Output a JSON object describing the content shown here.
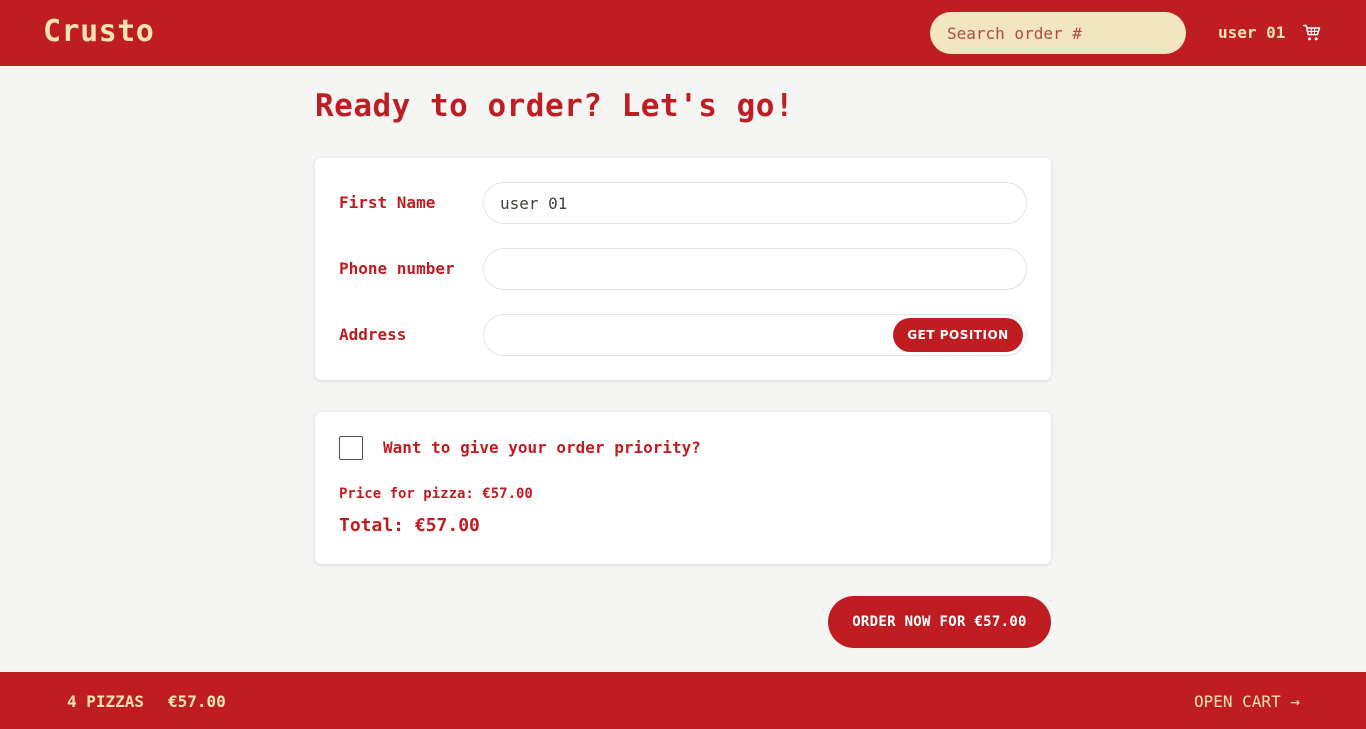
{
  "header": {
    "logo": "Crusto",
    "search_placeholder": "Search order #",
    "username": "user 01",
    "cart_icon": "cart-icon"
  },
  "main": {
    "title": "Ready to order? Let's go!",
    "form": {
      "first_name_label": "First Name",
      "first_name_value": "user 01",
      "phone_label": "Phone number",
      "phone_value": "",
      "address_label": "Address",
      "address_value": "",
      "get_position_label": "GET POSITION"
    },
    "priority": {
      "checkbox_checked": false,
      "label": "Want to give your order priority?",
      "price_line": "Price for pizza: €57.00",
      "total_line": "Total: €57.00"
    },
    "order_button_label": "ORDER NOW FOR €57.00"
  },
  "footer": {
    "pizzas": "4 PIZZAS",
    "total": "€57.00",
    "open_cart": "OPEN CART →"
  },
  "colors": {
    "brand": "#c01d22",
    "accent": "#f7e3b4",
    "search_bg": "#f3e5c0",
    "page_bg": "#f5f5f4"
  }
}
